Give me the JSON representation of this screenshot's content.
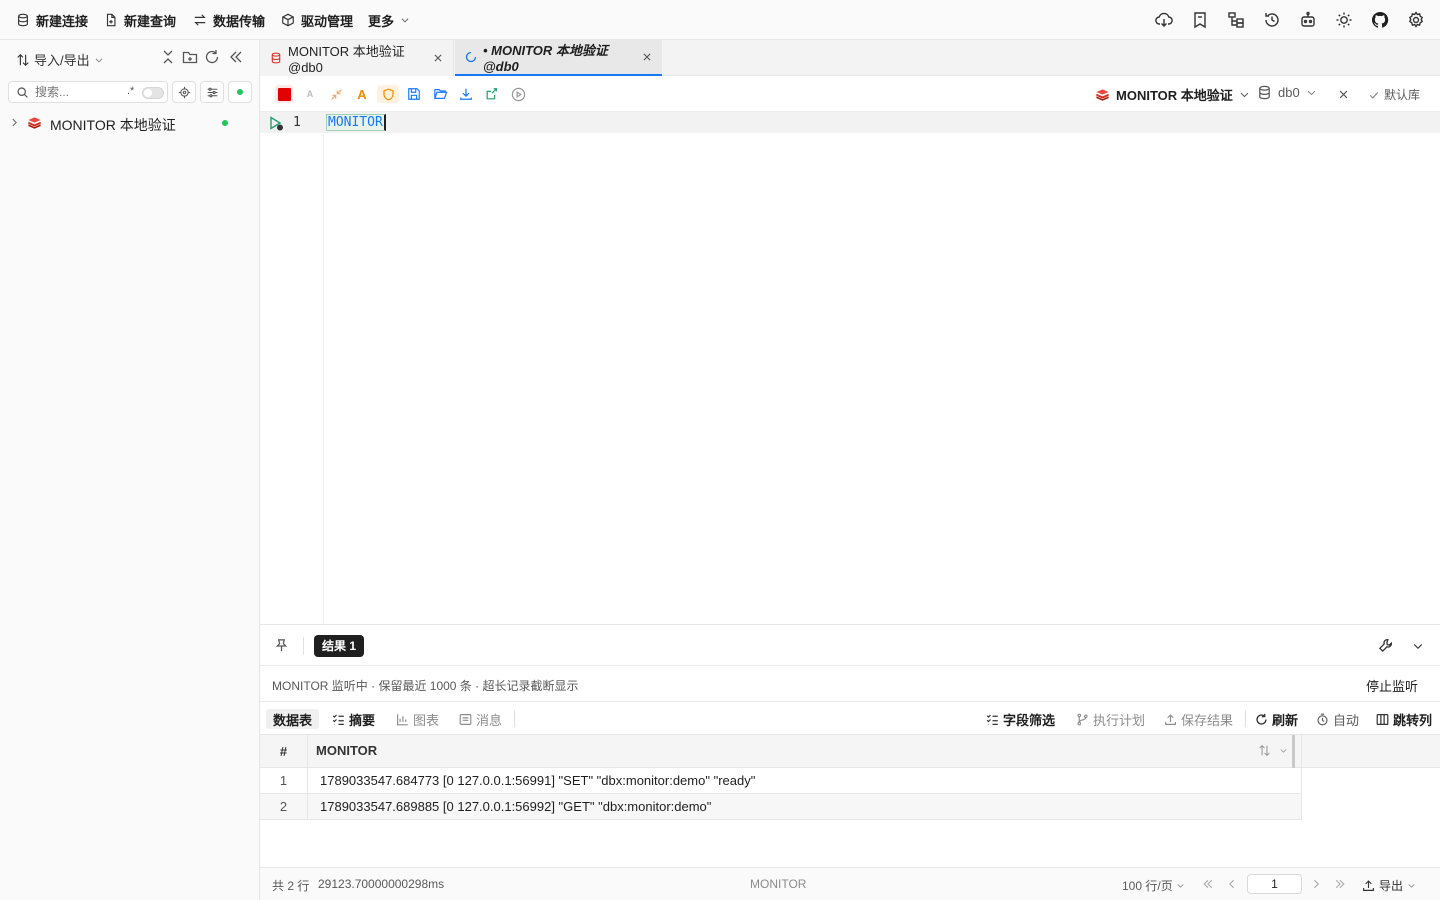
{
  "topbar": {
    "items": [
      "新建连接",
      "新建查询",
      "数据传输",
      "驱动管理",
      "更多"
    ]
  },
  "sidebar": {
    "import_export": "导入/导出",
    "search_placeholder": "搜索...",
    "regex_label": ".*",
    "tree": [
      {
        "label": "MONITOR 本地验证",
        "status": "connected"
      }
    ]
  },
  "tabs": [
    {
      "label": "MONITOR 本地验证@db0",
      "active": false
    },
    {
      "label": "• MONITOR 本地验证@db0",
      "active": true,
      "italic": true,
      "loading": true
    }
  ],
  "editor_toolbar": {
    "connection": "MONITOR 本地验证",
    "database": "db0",
    "default_db": "默认库"
  },
  "editor": {
    "lines": [
      {
        "number": "1",
        "text": "MONITOR"
      }
    ]
  },
  "results": {
    "tab_label": "结果 1",
    "info_text": "MONITOR 监听中 · 保留最近 1000 条 · 超长记录截断显示",
    "stop_label": "停止监听",
    "views": [
      "数据表",
      "摘要",
      "图表",
      "消息"
    ],
    "actions": [
      "字段筛选",
      "执行计划",
      "保存结果",
      "刷新",
      "自动",
      "跳转列"
    ],
    "columns": [
      "#",
      "MONITOR"
    ],
    "rows": [
      {
        "num": "1",
        "value": "1789033547.684773 [0 127.0.0.1:56991] \"SET\" \"dbx:monitor:demo\" \"ready\""
      },
      {
        "num": "2",
        "value": "1789033547.689885 [0 127.0.0.1:56992] \"GET\" \"dbx:monitor:demo\""
      }
    ]
  },
  "footer": {
    "row_count": "共 2 行",
    "duration": "29123.70000000298ms",
    "center": "MONITOR",
    "page_size": "100 行/页",
    "page": "1",
    "export": "导出"
  },
  "colors": {
    "accent": "#1677ff",
    "redis_red": "#d82c20",
    "status_green": "#22c55e",
    "orange": "#f08c00"
  }
}
